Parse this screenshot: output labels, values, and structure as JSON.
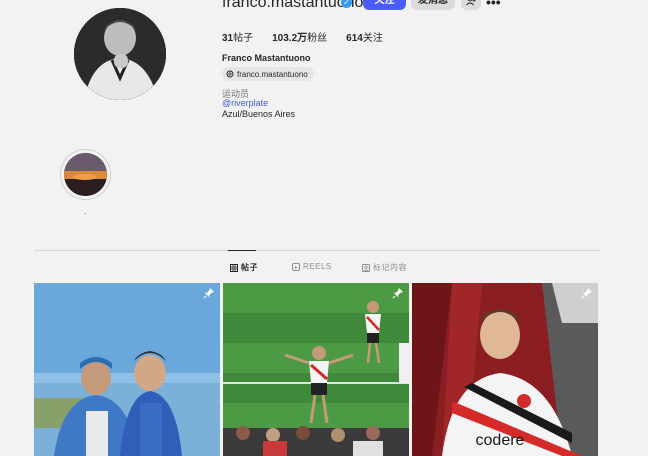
{
  "profile": {
    "username": "franco.mastantuono",
    "follow_label": "关注",
    "message_label": "发消息",
    "stats": {
      "posts_num": "31",
      "posts_label": "帖子",
      "followers_num": "103.2万",
      "followers_label": "粉丝",
      "following_num": "614",
      "following_label": "关注"
    },
    "full_name": "Franco Mastantuono",
    "threads_handle": "franco.mastantuono",
    "category": "运动员",
    "bio_link": "@riverplate",
    "location": "Azul/Buenos Aires"
  },
  "highlight": {
    "label": "."
  },
  "tabs": [
    {
      "label": "帖子",
      "icon": "grid-icon",
      "active": true
    },
    {
      "label": "REELS",
      "icon": "reels-icon",
      "active": false
    },
    {
      "label": "标记内容",
      "icon": "tagged-icon",
      "active": false
    }
  ],
  "posts": [
    {
      "desc_icon": "pin-icon",
      "jersey_text": ""
    },
    {
      "desc_icon": "pin-icon",
      "jersey_text": ""
    },
    {
      "desc_icon": "pin-icon",
      "jersey_text": "codere"
    }
  ],
  "colors": {
    "accent": "#4a5dfb",
    "link": "#3d5ad8",
    "verified": "#3897f0"
  }
}
